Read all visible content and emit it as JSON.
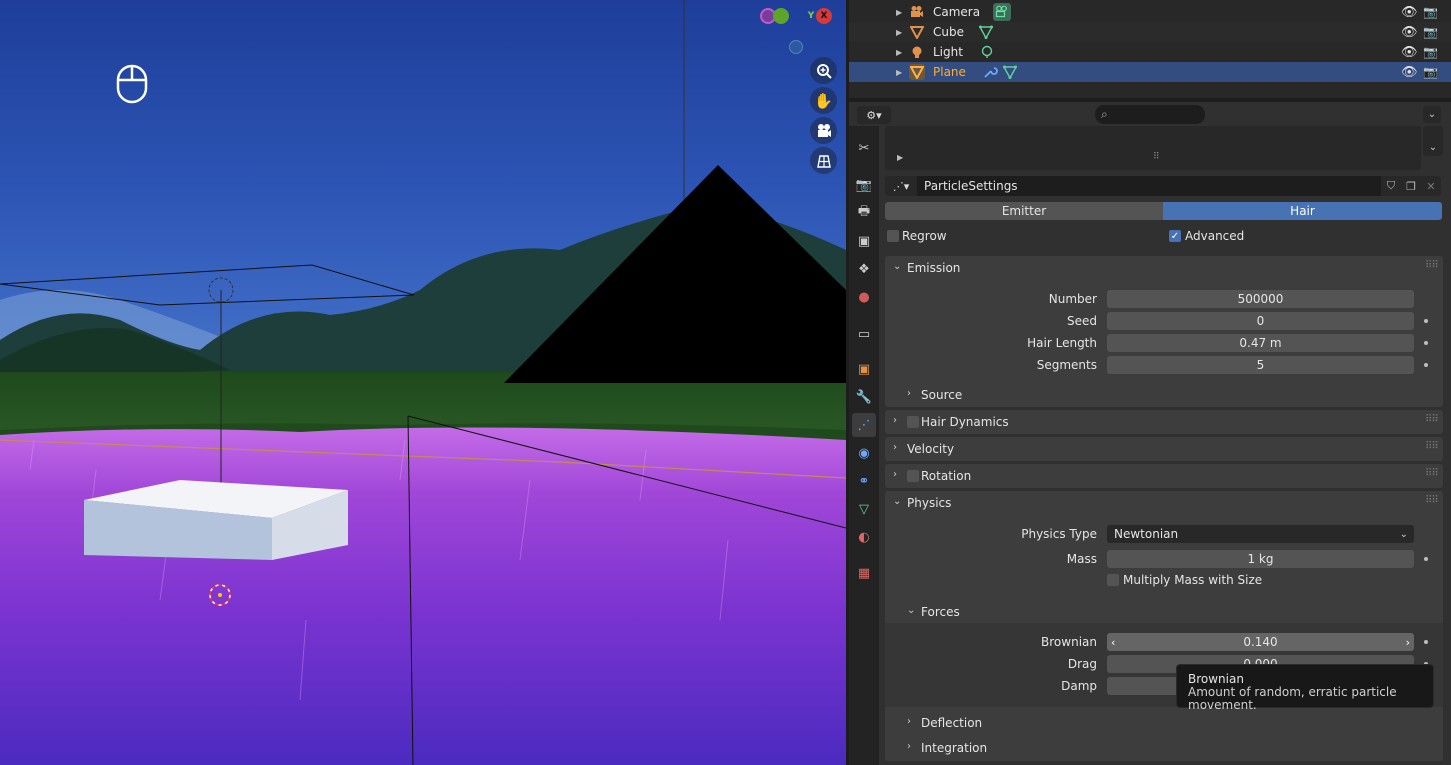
{
  "outliner": {
    "items": [
      {
        "name": "Camera",
        "obj_icon": "camera-object-icon",
        "data_icon": "camera-data-icon"
      },
      {
        "name": "Cube",
        "obj_icon": "mesh-object-icon",
        "data_icon": "mesh-data-icon"
      },
      {
        "name": "Light",
        "obj_icon": "light-object-icon",
        "data_icon": "light-data-icon"
      },
      {
        "name": "Plane",
        "obj_icon": "mesh-object-icon",
        "data_icon": "modifier-and-mesh-icons",
        "selected": true
      }
    ]
  },
  "properties": {
    "particle_settings_name": "ParticleSettings",
    "type_tabs": {
      "emitter": "Emitter",
      "hair": "Hair",
      "active": "Hair"
    },
    "regrow_label": "Regrow",
    "regrow_checked": false,
    "advanced_label": "Advanced",
    "advanced_checked": true,
    "emission": {
      "title": "Emission",
      "number_label": "Number",
      "number_value": "500000",
      "seed_label": "Seed",
      "seed_value": "0",
      "hair_length_label": "Hair Length",
      "hair_length_value": "0.47 m",
      "segments_label": "Segments",
      "segments_value": "5",
      "source_label": "Source"
    },
    "hair_dynamics_title": "Hair Dynamics",
    "velocity_title": "Velocity",
    "rotation_title": "Rotation",
    "physics": {
      "title": "Physics",
      "physics_type_label": "Physics Type",
      "physics_type_value": "Newtonian",
      "mass_label": "Mass",
      "mass_value": "1 kg",
      "multiply_mass_label": "Multiply Mass with Size",
      "forces_title": "Forces",
      "brownian_label": "Brownian",
      "brownian_value": "0.140",
      "drag_label": "Drag",
      "drag_value": "0.000",
      "damp_label": "Damp",
      "deflection_title": "Deflection",
      "integration_title": "Integration"
    }
  },
  "tooltip": {
    "title": "Brownian",
    "description": "Amount of random, erratic particle movement."
  },
  "colors": {
    "accent": "#4772b3",
    "selected_row": "#334d80",
    "selected_text": "#ffaf29",
    "grass": "#9b3fd6",
    "sky": "#2d55b5"
  }
}
